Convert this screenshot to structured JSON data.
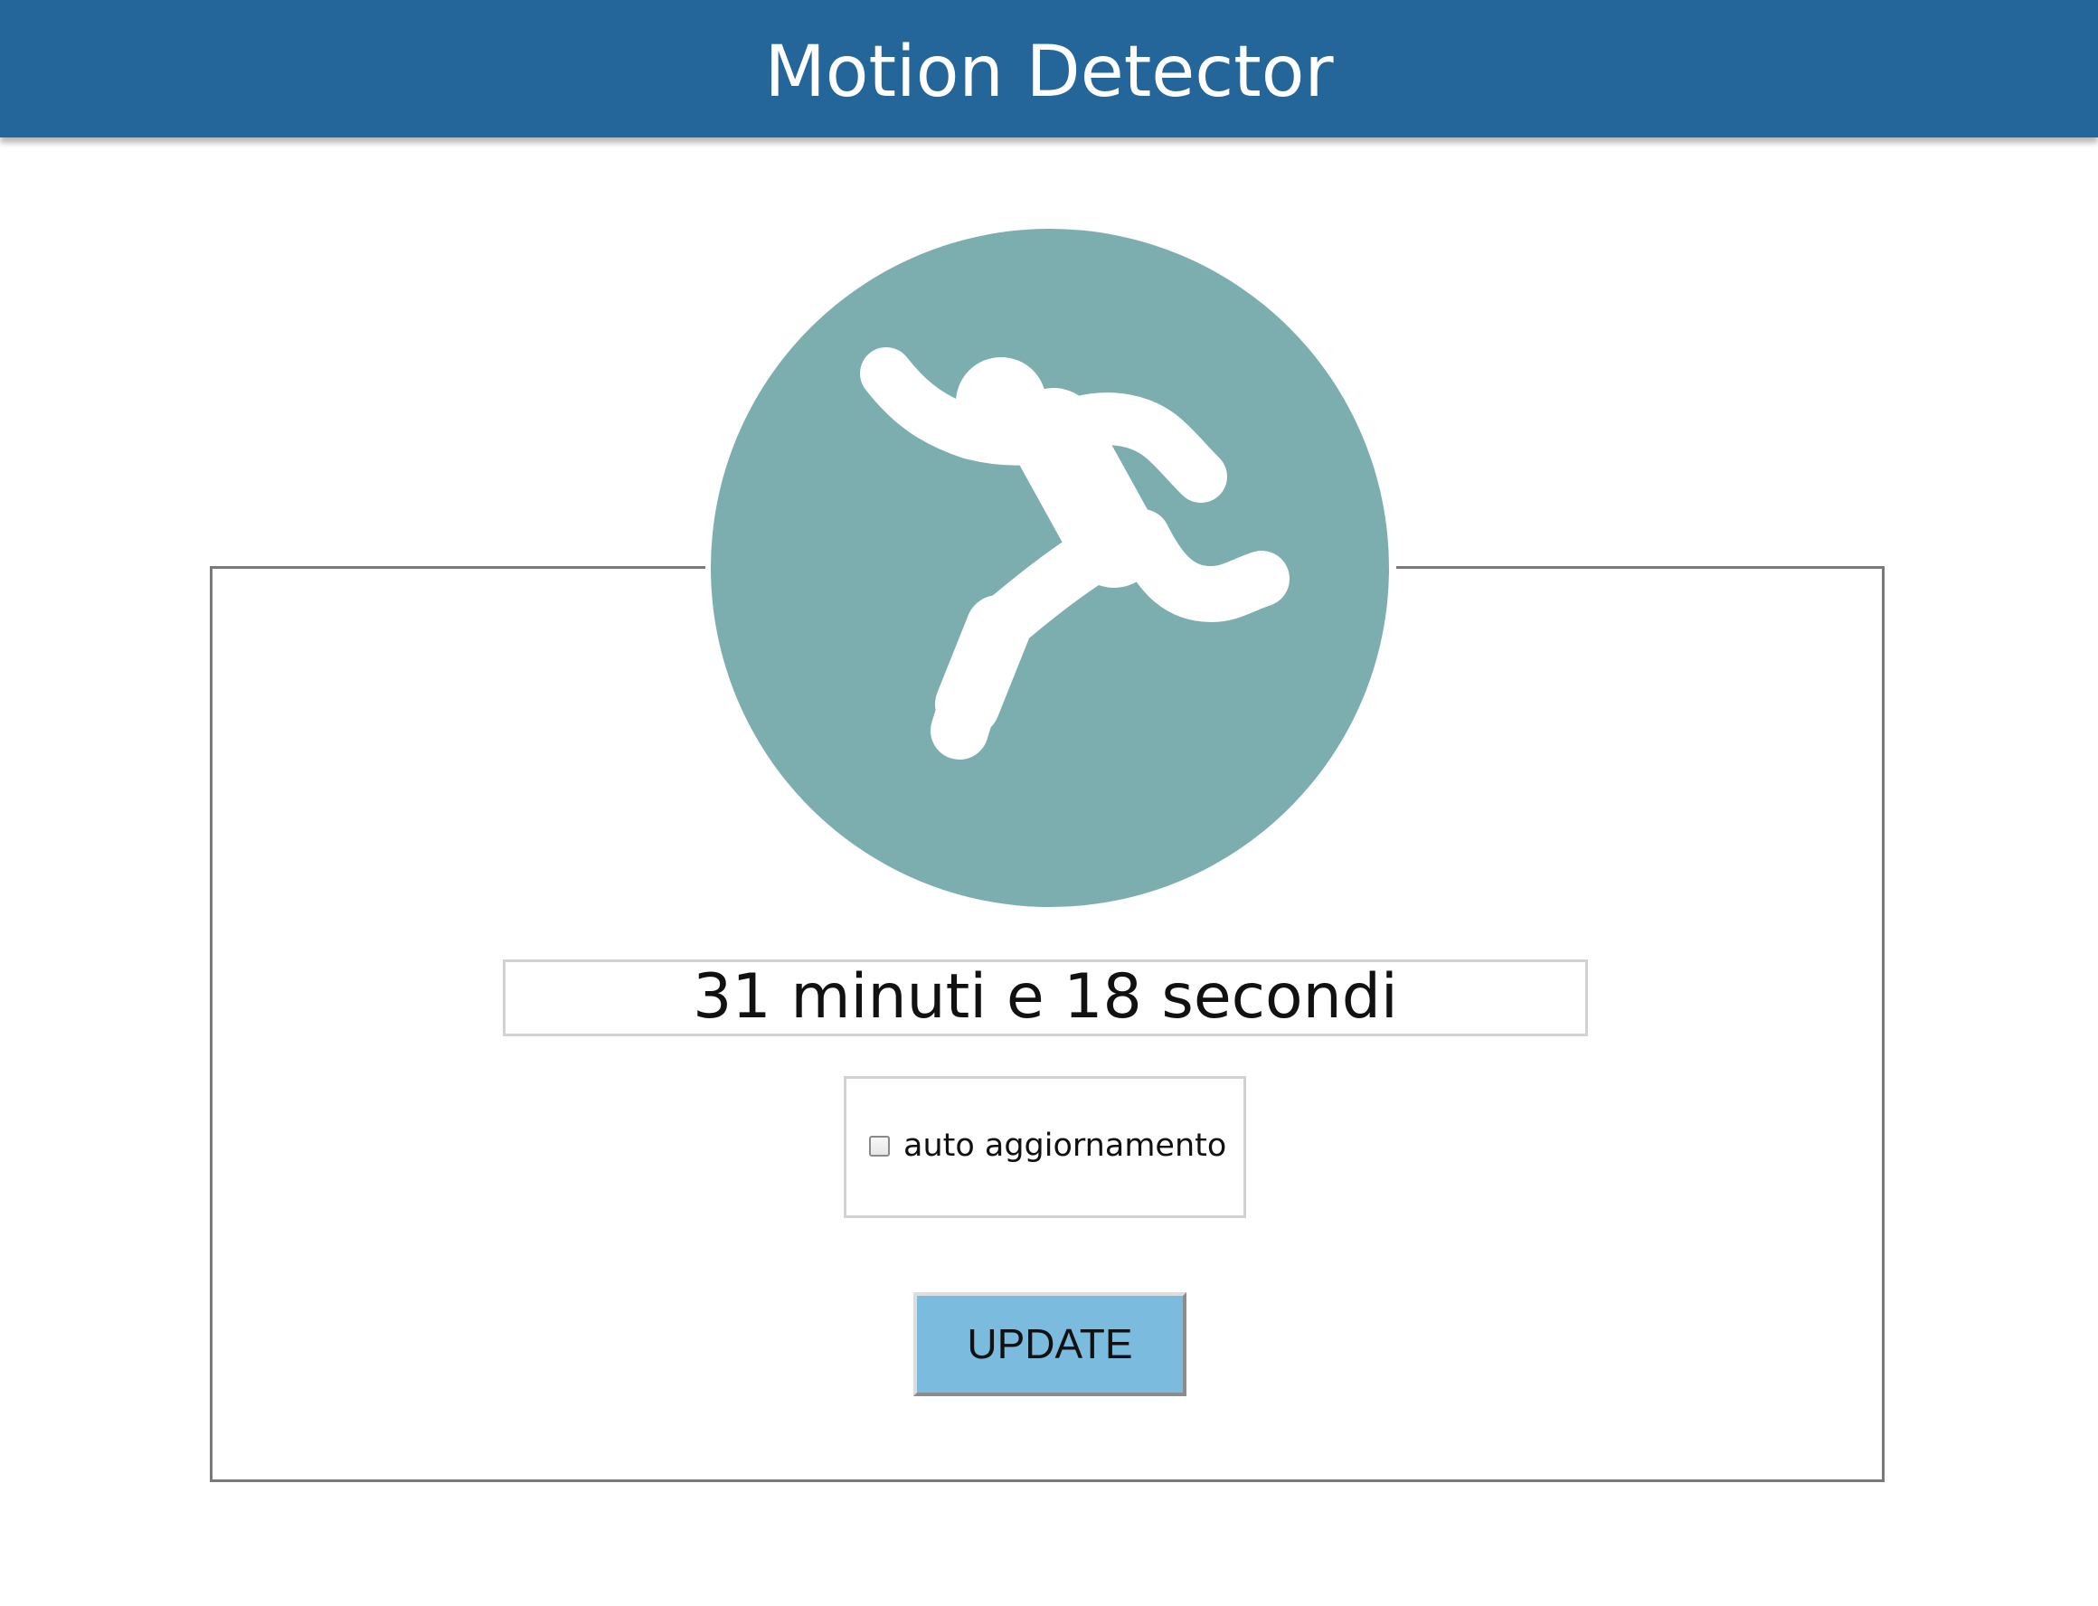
{
  "app": {
    "title": "Motion Detector"
  },
  "icon": {
    "name": "running-person-icon",
    "circle_color": "#7caeb0",
    "figure_color": "#ffffff"
  },
  "status": {
    "elapsed_text": "31 minuti e 18 secondi"
  },
  "auto_refresh": {
    "label": "auto aggiornamento",
    "checked": false
  },
  "update_button": {
    "label": "UPDATE"
  },
  "colors": {
    "header_bg": "#246699",
    "button_bg": "#7bbcde"
  }
}
